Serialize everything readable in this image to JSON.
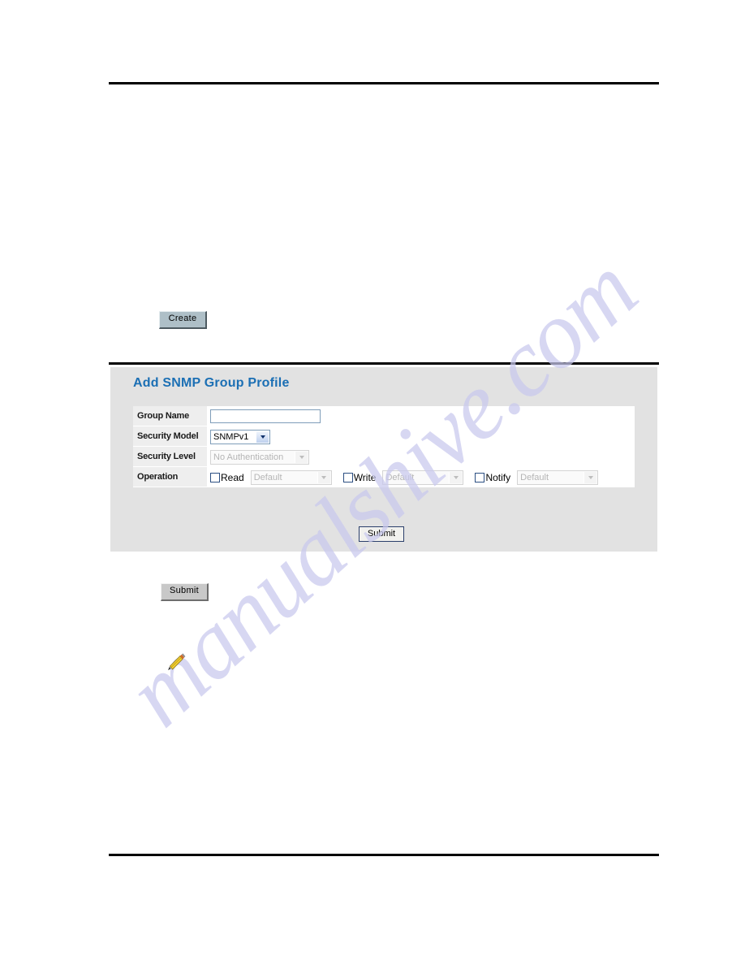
{
  "page": {
    "background_color": "#ffffff",
    "rule_color": "#000000"
  },
  "watermark": {
    "text": "manualshive.com",
    "color": "#c9c9ee"
  },
  "buttons": {
    "create_label": "Create",
    "submit_doc_label": "Submit"
  },
  "icons": {
    "pencil_note": "pencil-icon"
  },
  "panel": {
    "title": "Add SNMP Group Profile",
    "title_color": "#1b6fb4",
    "background_color": "#e2e2e2",
    "submit_label": "Submit",
    "rows": [
      {
        "label": "Group Name",
        "type": "text",
        "value": "",
        "placeholder": ""
      },
      {
        "label": "Security Model",
        "type": "select",
        "value": "SNMPv1",
        "enabled": true
      },
      {
        "label": "Security Level",
        "type": "select",
        "value": "No Authentication",
        "enabled": false
      },
      {
        "label": "Operation",
        "type": "operation",
        "items": [
          {
            "checkbox_label": "Read",
            "checked": false,
            "select_value": "Default",
            "enabled": false
          },
          {
            "checkbox_label": "Write",
            "checked": false,
            "select_value": "Default",
            "enabled": false
          },
          {
            "checkbox_label": "Notify",
            "checked": false,
            "select_value": "Default",
            "enabled": false
          }
        ]
      }
    ]
  }
}
